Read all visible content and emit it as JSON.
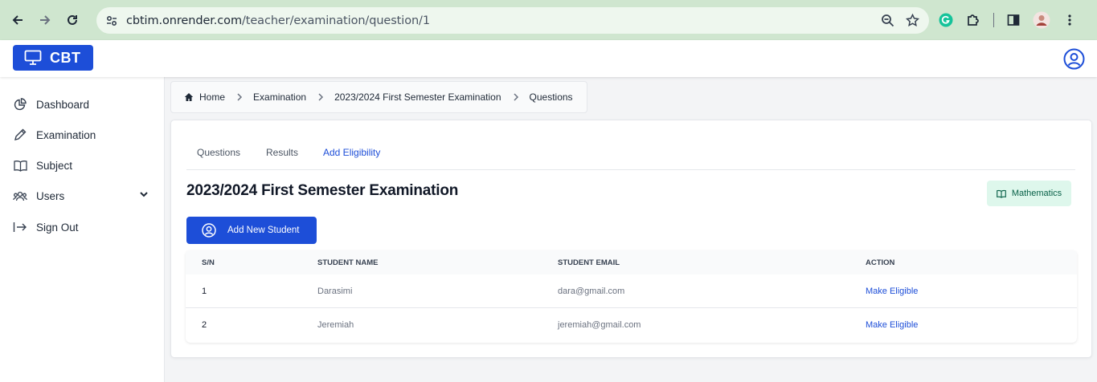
{
  "browser": {
    "url_host": "cbtim.onrender.com",
    "url_path": "/teacher/examination/question/1"
  },
  "app": {
    "logo_text": "CBT",
    "brand_color": "#1d4ed8"
  },
  "sidebar": {
    "items": [
      {
        "label": "Dashboard",
        "icon": "chart-pie-icon"
      },
      {
        "label": "Examination",
        "icon": "pencil-icon"
      },
      {
        "label": "Subject",
        "icon": "book-open-icon"
      },
      {
        "label": "Users",
        "icon": "users-icon"
      },
      {
        "label": "Sign Out",
        "icon": "sign-out-icon"
      }
    ]
  },
  "breadcrumb": {
    "home": "Home",
    "examination": "Examination",
    "exam": "2023/2024 First Semester Examination",
    "current": "Questions"
  },
  "tabs": [
    {
      "label": "Questions"
    },
    {
      "label": "Results"
    },
    {
      "label": "Add Eligibility",
      "active": true
    }
  ],
  "exam": {
    "title": "2023/2024 First Semester Examination",
    "subject": "Mathematics"
  },
  "add_button": {
    "label": "Add New Student"
  },
  "table": {
    "headers": [
      "S/N",
      "STUDENT NAME",
      "STUDENT EMAIL",
      "ACTION"
    ],
    "rows": [
      {
        "sn": "1",
        "name": "Darasimi",
        "email": "dara@gmail.com",
        "action": "Make Eligible"
      },
      {
        "sn": "2",
        "name": "Jeremiah",
        "email": "jeremiah@gmail.com",
        "action": "Make Eligible"
      }
    ]
  }
}
